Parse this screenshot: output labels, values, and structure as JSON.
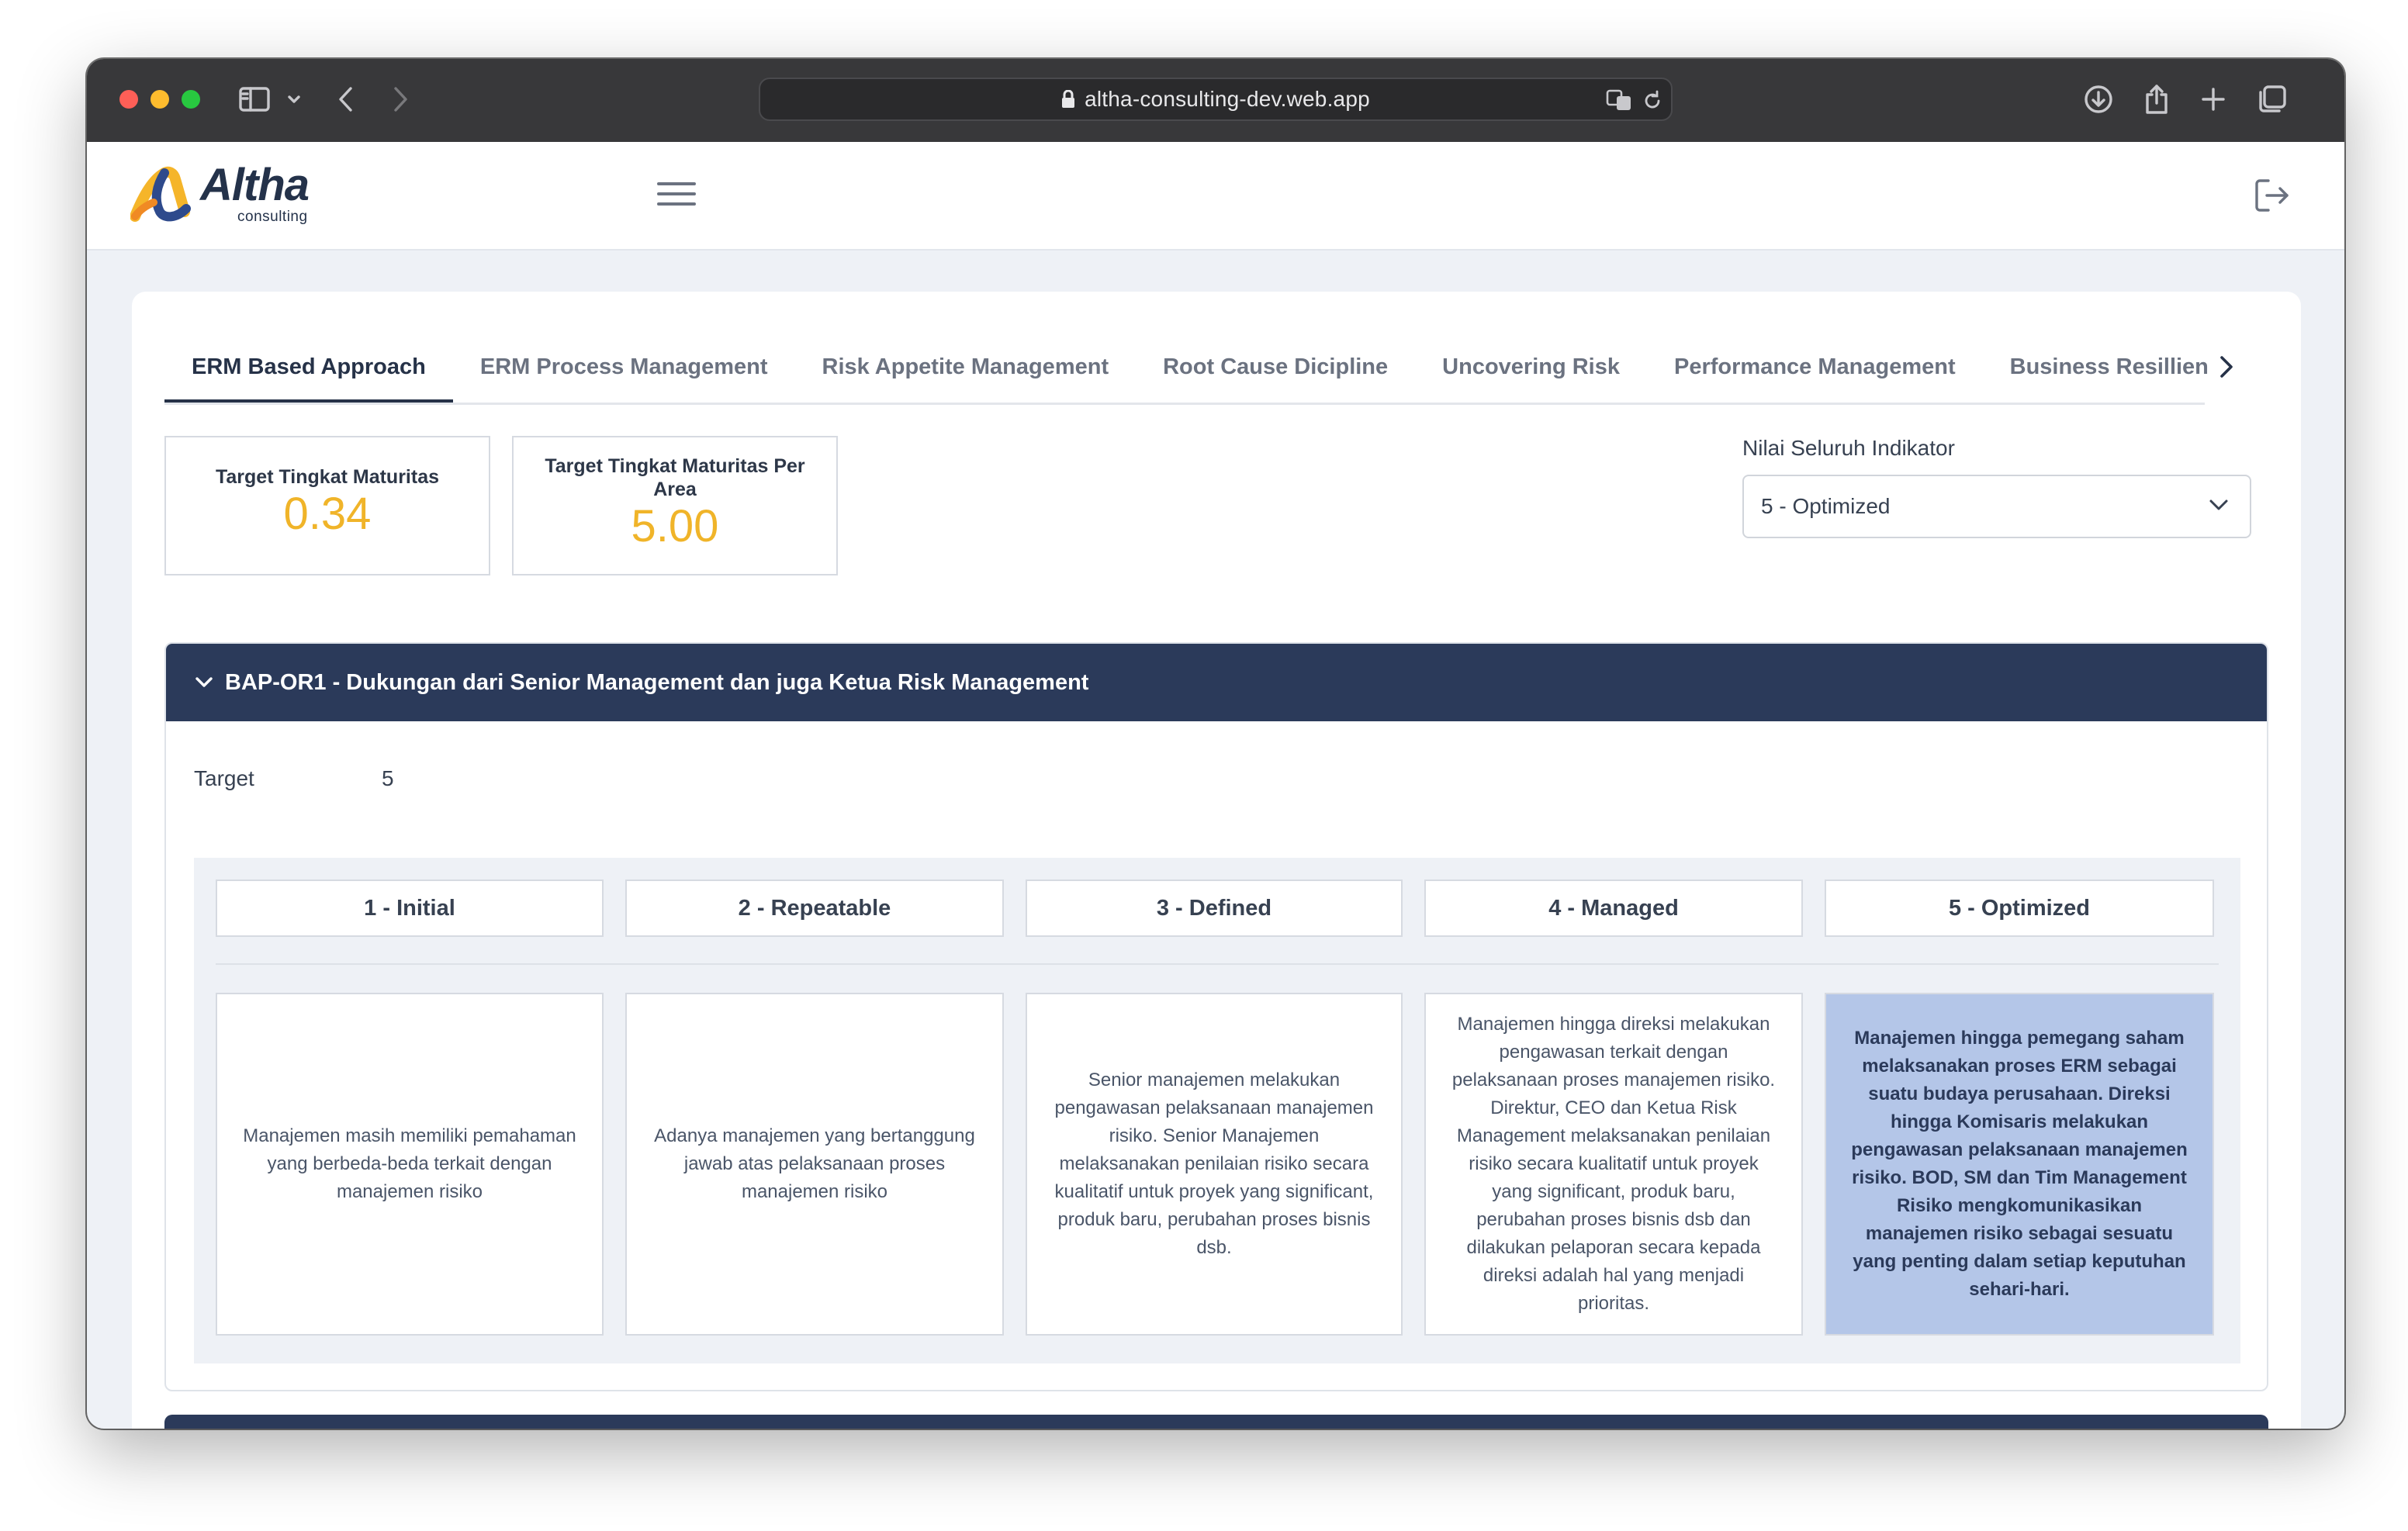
{
  "browser": {
    "url": "altha-consulting-dev.web.app"
  },
  "header": {
    "logo_name": "Altha",
    "logo_sub": "consulting"
  },
  "tabs": [
    {
      "label": "ERM Based Approach",
      "active": true
    },
    {
      "label": "ERM Process Management",
      "active": false
    },
    {
      "label": "Risk Appetite Management",
      "active": false
    },
    {
      "label": "Root Cause Dicipline",
      "active": false
    },
    {
      "label": "Uncovering Risk",
      "active": false
    },
    {
      "label": "Performance Management",
      "active": false
    },
    {
      "label": "Business Resillien",
      "active": false
    }
  ],
  "stats": {
    "target_maturity_label": "Target Tingkat Maturitas",
    "target_maturity_value": "0.34",
    "target_area_label": "Target Tingkat Maturitas Per Area",
    "target_area_value": "5.00"
  },
  "indicator": {
    "label": "Nilai Seluruh Indikator",
    "selected": "5 - Optimized"
  },
  "accordion": {
    "title": "BAP-OR1 - Dukungan dari Senior Management dan juga Ketua Risk Management",
    "target_label": "Target",
    "target_value": "5",
    "levels": [
      {
        "label": "1 - Initial",
        "description": "Manajemen masih memiliki pemahaman yang berbeda-beda terkait dengan manajemen risiko"
      },
      {
        "label": "2 - Repeatable",
        "description": "Adanya manajemen yang bertanggung jawab atas pelaksanaan proses manajemen risiko"
      },
      {
        "label": "3 - Defined",
        "description": "Senior manajemen melakukan pengawasan pelaksanaan manajemen risiko. Senior Manajemen melaksanakan penilaian risiko secara kualitatif untuk proyek yang significant, produk baru, perubahan proses bisnis dsb."
      },
      {
        "label": "4 - Managed",
        "description": "Manajemen hingga direksi melakukan pengawasan terkait dengan pelaksanaan proses manajemen risiko. Direktur, CEO dan Ketua Risk Management melaksanakan penilaian risiko secara kualitatif untuk proyek yang significant, produk baru, perubahan proses bisnis dsb dan dilakukan pelaporan secara kepada direksi adalah hal yang menjadi prioritas."
      },
      {
        "label": "5 - Optimized",
        "description": "Manajemen hingga pemegang saham melaksanakan proses ERM sebagai suatu budaya perusahaan. Direksi hingga Komisaris melakukan pengawasan pelaksanaan manajemen risiko. BOD, SM dan Tim Management Risiko mengkomunikasikan manajemen risiko sebagai sesuatu yang penting dalam setiap keputuhan sehari-hari."
      }
    ],
    "selected_level": "5 - Optimized"
  },
  "colors": {
    "navy": "#2b3a5a",
    "accent_gold": "#f0b429",
    "selected_level_bg": "#b4c6e8"
  }
}
